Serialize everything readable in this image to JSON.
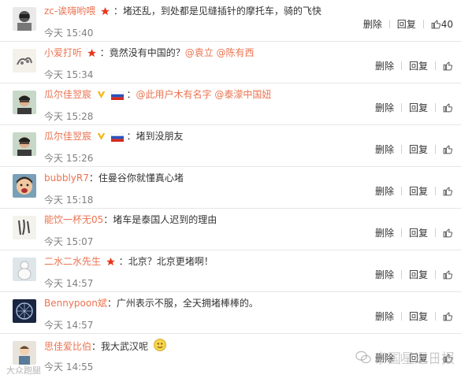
{
  "colors": {
    "username": "#eb7350",
    "time": "#808080",
    "star": "#e8381e",
    "vip": "#f6b617"
  },
  "actions": {
    "delete": "删除",
    "reply": "回复"
  },
  "comments": [
    {
      "user": "zc-诶嗨哟喂",
      "text": "堵还乱，到处都是见缝插针的摩托车，骑的飞快",
      "mentions": [],
      "time": "今天 15:40",
      "likes": "40",
      "badges": [
        "star-badge"
      ]
    },
    {
      "user": "小爱打听",
      "text": "竟然没有中国的？",
      "mentions": [
        "@袁立",
        "@陈有西"
      ],
      "time": "今天 15:34",
      "likes": "",
      "badges": [
        "star-badge"
      ]
    },
    {
      "user": "瓜尔佳翌宸",
      "text": "",
      "mentions": [
        "@此用户木有名字",
        "@泰濛中国妞"
      ],
      "time": "今天 15:28",
      "likes": "",
      "badges": [
        "vip-badge",
        "russia-flag-icon"
      ]
    },
    {
      "user": "瓜尔佳翌宸",
      "text": "堵到没朋友",
      "mentions": [],
      "time": "今天 15:26",
      "likes": "",
      "badges": [
        "vip-badge",
        "russia-flag-icon"
      ]
    },
    {
      "user": "bubblyR7",
      "text": "住曼谷你就懂真心堵",
      "mentions": [],
      "time": "今天 15:18",
      "likes": "",
      "badges": []
    },
    {
      "user": "能饮一杯无05",
      "text": "堵车是泰国人迟到的理由",
      "mentions": [],
      "time": "今天 15:07",
      "likes": "",
      "badges": []
    },
    {
      "user": "二水二水先生",
      "text": "北京？北京更堵啊！",
      "mentions": [],
      "time": "今天 14:57",
      "likes": "",
      "badges": [
        "star-badge"
      ]
    },
    {
      "user": "Bennypoon斌",
      "text": "广州表示不服，全天拥堵棒棒的。",
      "mentions": [],
      "time": "今天 14:57",
      "likes": "",
      "badges": []
    },
    {
      "user": "思佳爱比伯",
      "text": "我大武汉呢",
      "mentions": [],
      "time": "今天 14:55",
      "likes": "",
      "badges": [
        "smile-emoji"
      ]
    }
  ],
  "watermark": {
    "text": "泰国星暹日报",
    "corner": "大众跑腿"
  }
}
